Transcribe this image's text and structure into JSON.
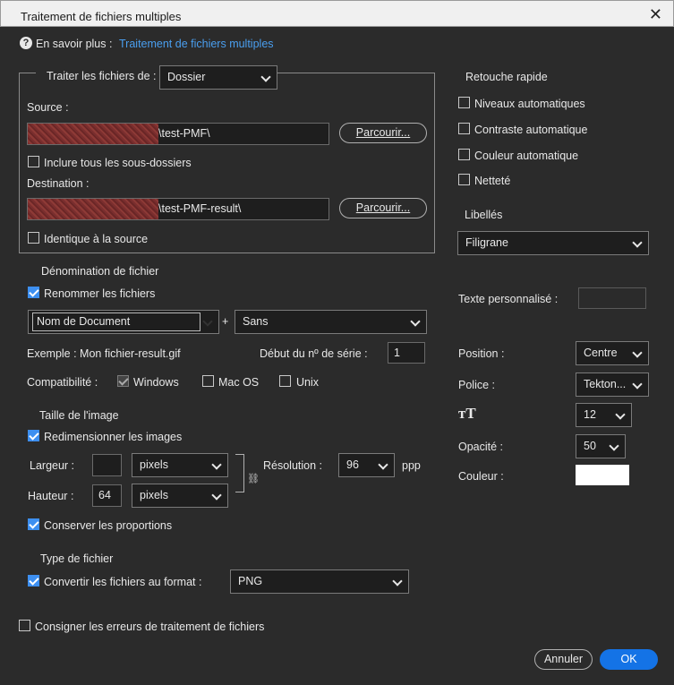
{
  "window": {
    "title": "Traitement de fichiers multiples"
  },
  "learn_more": {
    "label": "En savoir plus :",
    "link": "Traitement de fichiers multiples"
  },
  "process": {
    "label": "Traiter les fichiers de :",
    "selected": "Dossier",
    "source_label": "Source :",
    "source_path": "\\test-PMF\\",
    "browse_label": "Parcourir...",
    "include_subfolders": "Inclure tous les sous-dossiers",
    "destination_label": "Destination :",
    "destination_path": "\\test-PMF-result\\",
    "same_as_source": "Identique à la source"
  },
  "naming": {
    "heading": "Dénomination de fichier",
    "rename_label": "Renommer les fichiers",
    "field1": "Nom de Document",
    "plus": "+",
    "field2": "Sans",
    "example": "Exemple : Mon fichier-result.gif",
    "serial_label": "Début du nº de série :",
    "serial_value": "1",
    "compat_label": "Compatibilité :",
    "windows": "Windows",
    "macos": "Mac OS",
    "unix": "Unix"
  },
  "image_size": {
    "heading": "Taille de l'image",
    "resize_label": "Redimensionner les images",
    "width_label": "Largeur :",
    "width_value": "",
    "width_unit": "pixels",
    "height_label": "Hauteur :",
    "height_value": "64",
    "height_unit": "pixels",
    "resolution_label": "Résolution :",
    "resolution_value": "96",
    "resolution_unit": "ppp",
    "constrain_label": "Conserver les proportions"
  },
  "file_type": {
    "heading": "Type de fichier",
    "convert_label": "Convertir les fichiers au format :",
    "format": "PNG"
  },
  "log_errors": "Consigner les erreurs de traitement de fichiers",
  "quick_fix": {
    "heading": "Retouche rapide",
    "auto_levels": "Niveaux automatiques",
    "auto_contrast": "Contraste automatique",
    "auto_color": "Couleur automatique",
    "sharpen": "Netteté"
  },
  "labels": {
    "heading": "Libellés",
    "type": "Filigrane",
    "custom_text_label": "Texte personnalisé :",
    "custom_text_value": "",
    "position_label": "Position :",
    "position_value": "Centre",
    "font_label": "Police :",
    "font_value": "Tekton...",
    "size_icon": "text-size-icon",
    "size_value": "12",
    "opacity_label": "Opacité :",
    "opacity_value": "50",
    "color_label": "Couleur :",
    "color_value": "#ffffff"
  },
  "buttons": {
    "cancel": "Annuler",
    "ok": "OK"
  }
}
